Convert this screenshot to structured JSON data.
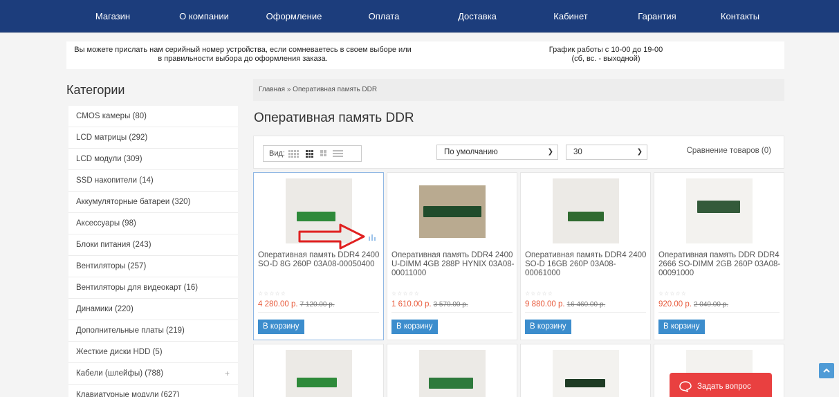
{
  "nav": [
    "Магазин",
    "О компании",
    "Оформление",
    "Оплата",
    "Доставка",
    "Кабинет",
    "Гарантия",
    "Контакты"
  ],
  "banner": {
    "left_line1": "Вы можете прислать нам серийный номер устройства, если сомневаетесь в своем выборе или",
    "left_line2": "в правильности выбора до оформления заказа.",
    "right_line1": "График работы с 10-00 до 19-00",
    "right_line2": "(сб, вс. - выходной)"
  },
  "sidebar": {
    "title": "Категории",
    "items": [
      "CMOS камеры (80)",
      "LCD матрицы (292)",
      "LCD модули (309)",
      "SSD накопители (14)",
      "Аккумуляторные батареи (320)",
      "Аксессуары (98)",
      "Блоки питания (243)",
      "Вентиляторы (257)",
      "Вентиляторы для видеокарт (16)",
      "Динамики (220)",
      "Дополнительные платы (219)",
      "Жесткие диски HDD (5)",
      "Кабели (шлейфы) (788)",
      "Клавиатурные модули (627)"
    ],
    "expand_symbol": "+"
  },
  "breadcrumb": "Главная » Оперативная память DDR",
  "page_title": "Оперативная память DDR",
  "toolbar": {
    "view_label": "Вид:",
    "sort_value": "По умолчанию",
    "limit_value": "30",
    "compare": "Сравнение товаров (0)"
  },
  "products": [
    {
      "name": "Оперативная память DDR4 2400 SO-D 8G 260P 03A08-00050400",
      "price": "4 280.00 р.",
      "old": "7 120.00 р.",
      "button": "В корзину"
    },
    {
      "name": "Оперативная память DDR4 2400 U-DIMM 4GB 288P HYNIX 03A08-00011000",
      "price": "1 610.00 р.",
      "old": "3 570.00 р.",
      "button": "В корзину"
    },
    {
      "name": "Оперативная память DDR4 2400 SO-D 16GB 260P 03A08-00061000",
      "price": "9 880.00 р.",
      "old": "16 460.00 р.",
      "button": "В корзину"
    },
    {
      "name": "Оперативная память DDR DDR4 2666 SO-DIMM 2GB 260P 03A08-00091000",
      "price": "920.00 р.",
      "old": "2 040.00 р.",
      "button": "В корзину"
    }
  ],
  "stars": "☆☆☆☆☆",
  "ask_button": "Задать вопрос",
  "colors": {
    "nav_bg": "#1c3d7c",
    "price": "#e85a3b",
    "button": "#3c8dcd",
    "ask": "#e94040"
  }
}
